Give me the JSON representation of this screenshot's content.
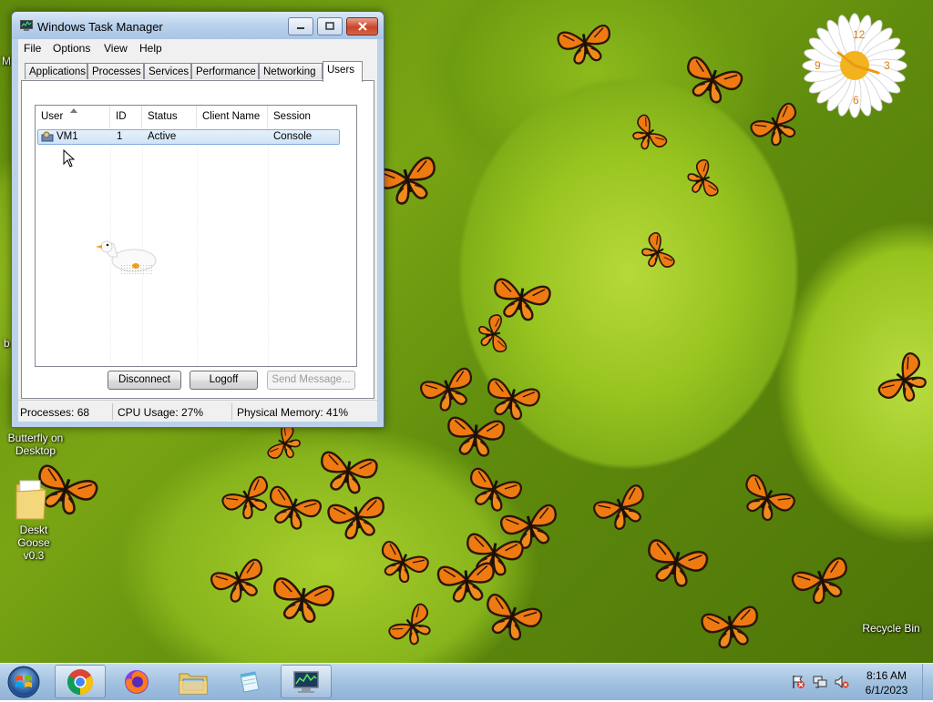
{
  "window": {
    "title": "Windows Task Manager",
    "menu": [
      "File",
      "Options",
      "View",
      "Help"
    ],
    "tabs": [
      "Applications",
      "Processes",
      "Services",
      "Performance",
      "Networking",
      "Users"
    ],
    "active_tab": "Users",
    "columns": [
      "User",
      "ID",
      "Status",
      "Client Name",
      "Session"
    ],
    "rows": [
      {
        "user": "VM1",
        "id": "1",
        "status": "Active",
        "client": "",
        "session": "Console"
      }
    ],
    "buttons": {
      "disconnect": "Disconnect",
      "logoff": "Logoff",
      "send_message": "Send Message..."
    },
    "status": {
      "processes": "Processes: 68",
      "cpu": "CPU Usage: 27%",
      "memory": "Physical Memory: 41%"
    }
  },
  "desktop": {
    "icons": [
      {
        "label_line1": "Butterfly on",
        "label_line2": "Desktop"
      },
      {
        "label_line1": "Deskt",
        "label_line2": "Goose v0.3"
      },
      {
        "label_line1": "Recycle Bin"
      }
    ],
    "edge_letters": [
      "M",
      "b"
    ]
  },
  "taskbar": {
    "apps": [
      "Google Chrome",
      "Firefox",
      "Windows Explorer",
      "Notepad",
      "Task Manager"
    ],
    "clock_time": "8:16 AM",
    "clock_date": "6/1/2023"
  },
  "colors": {
    "desktop_green": "#98c420",
    "butterfly_orange": "#ef7a12",
    "selection_blue": "#cfe3f7",
    "taskbar_blue": "#a6c4e2"
  }
}
